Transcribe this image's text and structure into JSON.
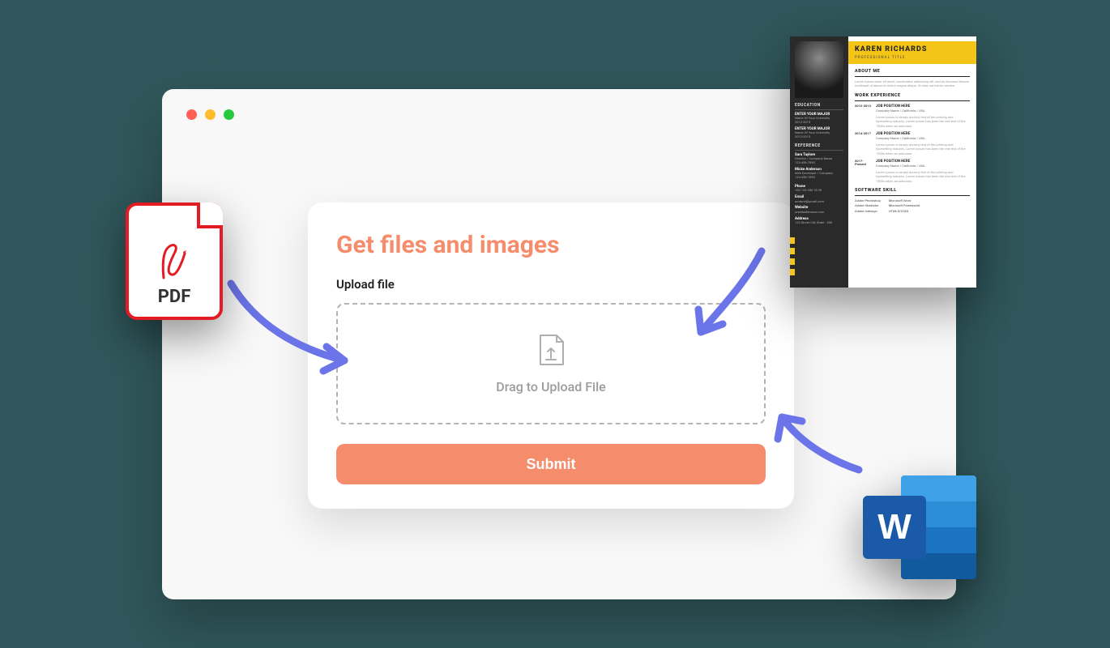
{
  "card": {
    "title": "Get files and images",
    "upload_label": "Upload file",
    "dropzone_text": "Drag to Upload File",
    "submit_label": "Submit"
  },
  "pdf_icon": {
    "label": "PDF"
  },
  "word_icon": {
    "letter": "W"
  },
  "resume": {
    "name": "KAREN RICHARDS",
    "role": "PROFESSIONAL TITLE",
    "sections": {
      "about": "ABOUT ME",
      "work": "WORK EXPERIENCE",
      "skill": "SOFTWARE SKILL",
      "education": "EDUCATION",
      "reference": "REFERENCE"
    },
    "about_text": "Lorem ipsum dolor sit amet, consectetur adipiscing elit, sed do eiusmod tempor incididunt ut labore et dolore magna aliqua. Ut enim ad minim veniam.",
    "education": [
      {
        "major": "ENTER YOUR MAJOR",
        "uni": "Name Of Your University",
        "years": "2012-2015"
      },
      {
        "major": "ENTER YOUR MAJOR",
        "uni": "Name Of Your University",
        "years": "2012-2015"
      }
    ],
    "references": [
      {
        "name": "Sara Taylore",
        "title": "Director / Company Name",
        "phone": "123-456-7890"
      },
      {
        "name": "Micke Anderson",
        "title": "Web Developer / Company",
        "phone": "123-456-7890"
      }
    ],
    "contact": {
      "phone_label": "Phone",
      "phone": "+00 123 456 78 90",
      "email_label": "Email",
      "email": "urname@gmail.com",
      "web_label": "Website",
      "web": "urwebsitename.com",
      "addr_label": "Address",
      "addr": "123 Street City State - 456"
    },
    "experience": [
      {
        "years": "2012-2013",
        "position": "JOB POSITION HERE",
        "company": "Company Name / California / USA",
        "desc": "Lorem ipsum is simply dummy text of the printing and typesetting industry. Lorem ipsum has been the real text of the 1500s when an unknown."
      },
      {
        "years": "2014-2017",
        "position": "JOB POSITION HERE",
        "company": "Company Name / California / USA",
        "desc": "Lorem ipsum is simply dummy text of the printing and typesetting industry. Lorem ipsum has been the real text of the 1500s when an unknown."
      },
      {
        "years": "2017-Present",
        "position": "JOB POSITION HERE",
        "company": "Company Name / California / USA",
        "desc": "Lorem ipsum is simply dummy text of the printing and typesetting industry. Lorem ipsum has been the real text of the 1500s when an unknown."
      }
    ],
    "skills_left": [
      "Adobe Photoshop",
      "Adobe Illustrator",
      "Adobe Indesign"
    ],
    "skills_right": [
      "Microsoft Word",
      "Microsoft Powerpoint",
      "HTML5/CSS3"
    ]
  },
  "colors": {
    "accent": "#f58d6c",
    "bg_teal": "#30575b",
    "pdf_red": "#e31b23",
    "word_blue": "#1b5aa8",
    "resume_yellow": "#f4c417"
  }
}
